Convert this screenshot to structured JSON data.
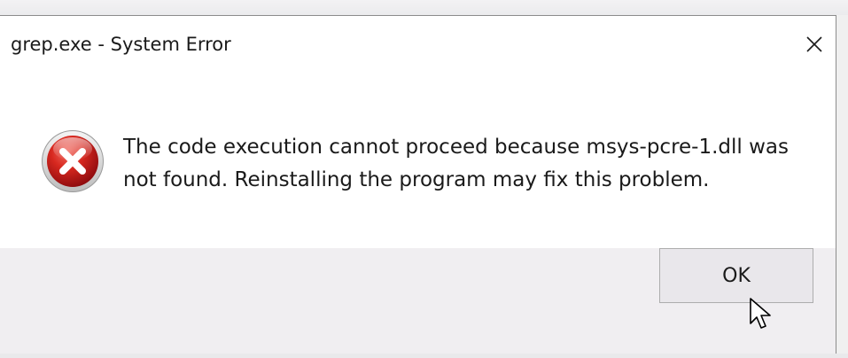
{
  "window": {
    "title": "grep.exe - System Error",
    "close_icon": "close-icon"
  },
  "message": {
    "icon": "error-icon",
    "text": "The code execution cannot proceed because msys-pcre-1.dll was not found. Reinstalling the program may fix this problem."
  },
  "buttons": {
    "ok_label": "OK"
  },
  "colors": {
    "error_red": "#c8161e",
    "footer_bg": "#f0eef1",
    "button_border": "#adadad"
  }
}
